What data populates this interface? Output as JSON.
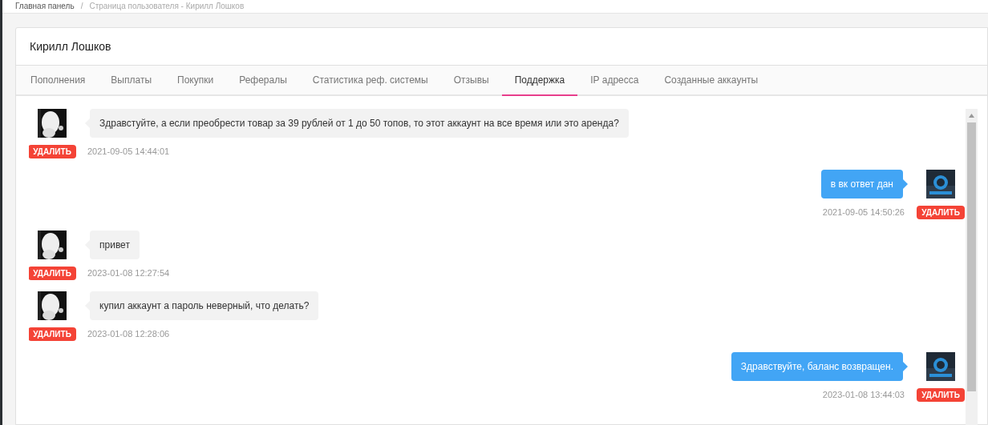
{
  "breadcrumb": [
    "Главная панель",
    "Страница пользователя - Кирилл Лошков"
  ],
  "breadcrumb_separator": "/",
  "user_name": "Кирилл Лошков",
  "tabs": [
    {
      "label": "Пополнения",
      "selected": false
    },
    {
      "label": "Выплаты",
      "selected": false
    },
    {
      "label": "Покупки",
      "selected": false
    },
    {
      "label": "Рефералы",
      "selected": false
    },
    {
      "label": "Статистика реф. системы",
      "selected": false
    },
    {
      "label": "Отзывы",
      "selected": false
    },
    {
      "label": "Поддержка",
      "selected": true
    },
    {
      "label": "IP адресса",
      "selected": false
    },
    {
      "label": "Созданные аккаунты",
      "selected": false
    }
  ],
  "messages": [
    {
      "kind": "user",
      "text": "Здравстуйте, а если преобрести товар за 39 рублей от 1 до 50 топов, то этот аккаунт на все время или это аренда?",
      "time": "2021-09-05 14:44:01",
      "delete": "УДАЛИТЬ"
    },
    {
      "kind": "admin",
      "text": "в вк ответ дан",
      "time": "2021-09-05 14:50:26",
      "delete": "УДАЛИТЬ"
    },
    {
      "kind": "user",
      "text": "привет",
      "time": "2023-01-08 12:27:54",
      "delete": "УДАЛИТЬ"
    },
    {
      "kind": "user",
      "text": "купил аккаунт а пароль неверный, что делать?",
      "time": "2023-01-08 12:28:06",
      "delete": "УДАЛИТЬ"
    },
    {
      "kind": "admin",
      "text": "Здравствуйте, баланс возвращен.",
      "time": "2023-01-08 13:44:03",
      "delete": "УДАЛИТЬ"
    }
  ]
}
